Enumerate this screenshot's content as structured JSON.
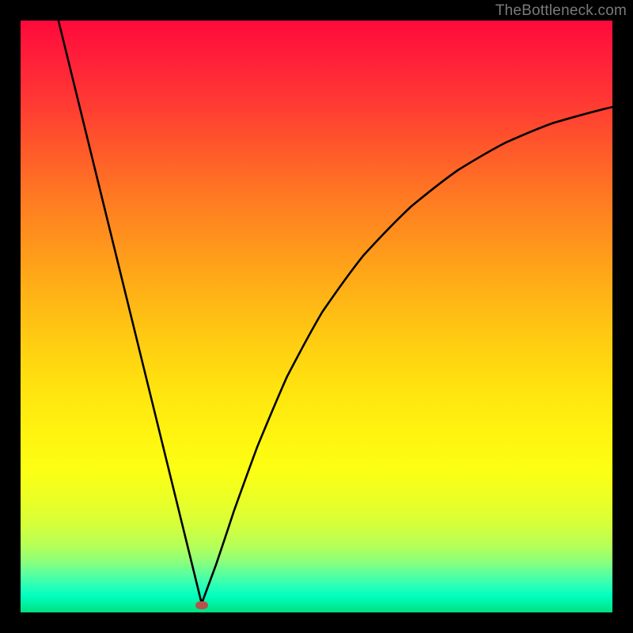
{
  "watermark": "TheBottleneck.com",
  "chart_data": {
    "type": "line",
    "title": "",
    "xlabel": "",
    "ylabel": "",
    "xlim": [
      0,
      100
    ],
    "ylim": [
      0,
      100
    ],
    "minimum_x": 30.6,
    "marker": {
      "x_frac": 0.306,
      "y_frac": 0.988
    },
    "left_branch": [
      {
        "x_frac": 0.064,
        "y_frac": 0.0
      },
      {
        "x_frac": 0.306,
        "y_frac": 0.985
      }
    ],
    "right_branch": [
      {
        "x_frac": 0.306,
        "y_frac": 0.985
      },
      {
        "x_frac": 0.33,
        "y_frac": 0.92
      },
      {
        "x_frac": 0.36,
        "y_frac": 0.83
      },
      {
        "x_frac": 0.4,
        "y_frac": 0.72
      },
      {
        "x_frac": 0.45,
        "y_frac": 0.602
      },
      {
        "x_frac": 0.51,
        "y_frac": 0.492
      },
      {
        "x_frac": 0.58,
        "y_frac": 0.396
      },
      {
        "x_frac": 0.66,
        "y_frac": 0.314
      },
      {
        "x_frac": 0.74,
        "y_frac": 0.252
      },
      {
        "x_frac": 0.82,
        "y_frac": 0.206
      },
      {
        "x_frac": 0.9,
        "y_frac": 0.173
      },
      {
        "x_frac": 1.0,
        "y_frac": 0.146
      }
    ]
  }
}
